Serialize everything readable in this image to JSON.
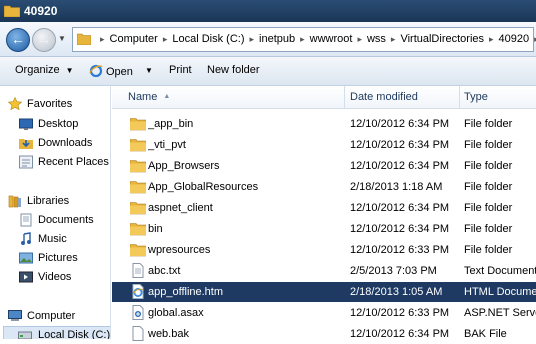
{
  "window": {
    "title": "40920"
  },
  "address": {
    "crumbs": [
      "Computer",
      "Local Disk (C:)",
      "inetpub",
      "wwwroot",
      "wss",
      "VirtualDirectories",
      "40920"
    ]
  },
  "toolbar": {
    "organize": "Organize",
    "open": "Open",
    "print": "Print",
    "new_folder": "New folder"
  },
  "nav": {
    "favorites": {
      "label": "Favorites",
      "items": [
        "Desktop",
        "Downloads",
        "Recent Places"
      ]
    },
    "libraries": {
      "label": "Libraries",
      "items": [
        "Documents",
        "Music",
        "Pictures",
        "Videos"
      ]
    },
    "computer": {
      "label": "Computer",
      "items": [
        "Local Disk (C:)"
      ]
    }
  },
  "columns": {
    "name": "Name",
    "date": "Date modified",
    "type": "Type"
  },
  "files": [
    {
      "name": "_app_bin",
      "date": "12/10/2012 6:34 PM",
      "type": "File folder",
      "icon": "folder-icon"
    },
    {
      "name": "_vti_pvt",
      "date": "12/10/2012 6:34 PM",
      "type": "File folder",
      "icon": "folder-icon"
    },
    {
      "name": "App_Browsers",
      "date": "12/10/2012 6:34 PM",
      "type": "File folder",
      "icon": "folder-icon"
    },
    {
      "name": "App_GlobalResources",
      "date": "2/18/2013 1:18 AM",
      "type": "File folder",
      "icon": "folder-icon"
    },
    {
      "name": "aspnet_client",
      "date": "12/10/2012 6:34 PM",
      "type": "File folder",
      "icon": "folder-icon"
    },
    {
      "name": "bin",
      "date": "12/10/2012 6:34 PM",
      "type": "File folder",
      "icon": "folder-icon"
    },
    {
      "name": "wpresources",
      "date": "12/10/2012 6:33 PM",
      "type": "File folder",
      "icon": "folder-icon"
    },
    {
      "name": "abc.txt",
      "date": "2/5/2013 7:03 PM",
      "type": "Text Document",
      "icon": "text-file-icon"
    },
    {
      "name": "app_offline.htm",
      "date": "2/18/2013 1:05 AM",
      "type": "HTML Document",
      "icon": "html-file-icon",
      "selected": true
    },
    {
      "name": "global.asax",
      "date": "12/10/2012 6:33 PM",
      "type": "ASP.NET Server",
      "icon": "asax-file-icon"
    },
    {
      "name": "web.bak",
      "date": "12/10/2012 6:34 PM",
      "type": "BAK File",
      "icon": "file-icon"
    }
  ],
  "colors": {
    "selection": "#1e3a63",
    "titlebar": "#1b3656",
    "folder": "#e8b53c"
  }
}
